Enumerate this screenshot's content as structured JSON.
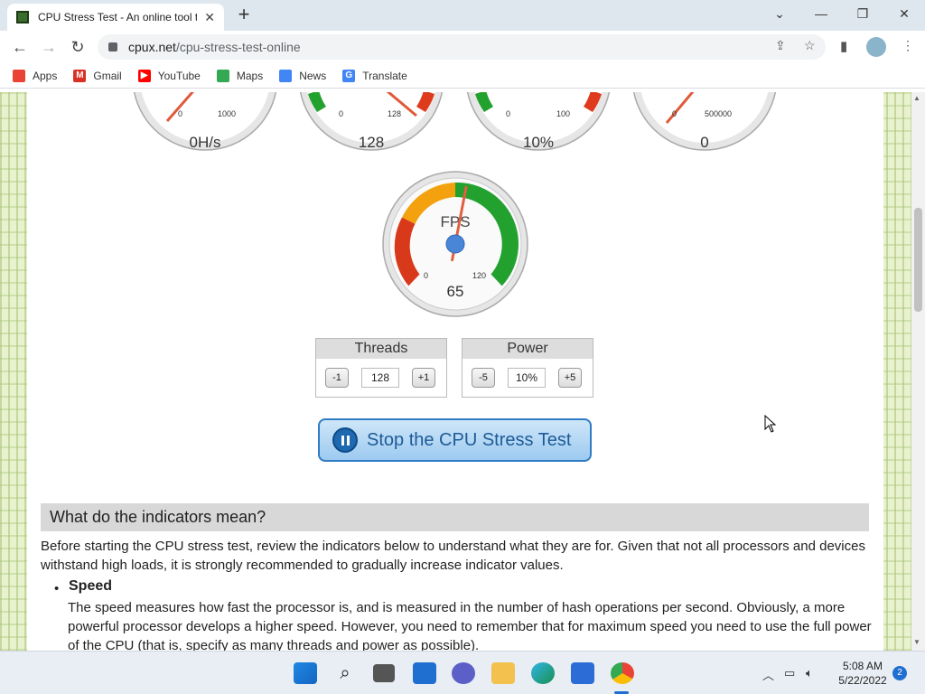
{
  "browser": {
    "tab_title": "CPU Stress Test - An online tool t",
    "tab_close": "✕",
    "new_tab": "+",
    "url_domain": "cpux.net",
    "url_path": "/cpu-stress-test-online",
    "window_controls": {
      "minimize": "—",
      "restore": "❐",
      "close": "✕",
      "tab_search": "⌄"
    },
    "bookmarks": [
      {
        "label": "Apps",
        "icon": "apps-grid-icon",
        "color": "#ea4335"
      },
      {
        "label": "Gmail",
        "icon": "gmail-icon",
        "color": "#d93025"
      },
      {
        "label": "YouTube",
        "icon": "youtube-icon",
        "color": "#ff0000"
      },
      {
        "label": "Maps",
        "icon": "maps-icon",
        "color": "#34a853"
      },
      {
        "label": "News",
        "icon": "news-icon",
        "color": "#4285f4"
      },
      {
        "label": "Translate",
        "icon": "translate-icon",
        "color": "#4285f4"
      }
    ]
  },
  "gauges": {
    "top": [
      {
        "min": "0",
        "max": "1000",
        "value": "0H/s"
      },
      {
        "min": "0",
        "max": "128",
        "value": "128"
      },
      {
        "min": "0",
        "max": "100",
        "value": "10%"
      },
      {
        "min": "0",
        "max": "500000",
        "value": "0"
      }
    ],
    "fps": {
      "title": "FPS",
      "min": "0",
      "max": "120",
      "value": "65",
      "fraction": 0.54
    }
  },
  "controls": {
    "threads": {
      "title": "Threads",
      "minus": "-1",
      "value": "128",
      "plus": "+1"
    },
    "power": {
      "title": "Power",
      "minus": "-5",
      "value": "10%",
      "plus": "+5"
    }
  },
  "stop_button": {
    "label": "Stop the CPU Stress Test"
  },
  "article": {
    "heading": "What do the indicators mean?",
    "intro": "Before starting the CPU stress test, review the indicators below to understand what they are for. Given that not all processors and devices withstand high loads, it is strongly recommended to gradually increase indicator values.",
    "bullet": "•",
    "speed_title": "Speed",
    "speed_text": "The speed measures how fast the processor is, and is measured in the number of hash operations per second. Obviously, a more powerful processor develops a higher speed. However, you need to remember that for maximum speed you need to use the full power of the CPU (that is, specify as many threads and power as possible)."
  },
  "taskbar": {
    "time": "5:08 AM",
    "date": "5/22/2022",
    "notifications": "2"
  }
}
